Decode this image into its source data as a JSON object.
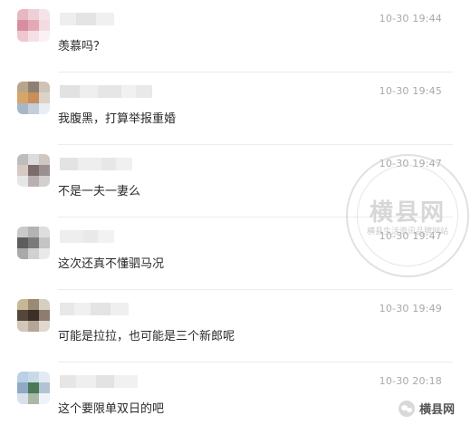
{
  "comments": [
    {
      "time": "10-30 19:44",
      "text": "羡慕吗？",
      "avatar": [
        "#e8b7c2",
        "#f0d0d8",
        "#f6e3e8",
        "#d88e9f",
        "#e4a9b6",
        "#f2dbe1",
        "#eec7d0",
        "#f4e0e6",
        "#fbf1f4"
      ],
      "name": [
        "#eeeeee",
        "#e4e4e4",
        "#f0f0f0"
      ]
    },
    {
      "time": "10-30 19:45",
      "text": "我腹黑，打算举报重婚",
      "avatar": [
        "#b9a58b",
        "#8f7f70",
        "#cfc3b8",
        "#d7a56a",
        "#c88f5a",
        "#ddd2c8",
        "#a7b7c6",
        "#c3ced9",
        "#e9eef2"
      ],
      "name": [
        "#e2e2e2",
        "#efefef",
        "#e6e6e6",
        "#f1f1f1",
        "#e9e9e9"
      ]
    },
    {
      "time": "10-30 19:47",
      "text": "不是一夫一妻么",
      "avatar": [
        "#bdbdbd",
        "#dcdcdc",
        "#cfc8c2",
        "#d6c9c4",
        "#7c6b6c",
        "#9c8f8f",
        "#e6e6e6",
        "#bbb0b0",
        "#d4cfcf"
      ],
      "name": [
        "#e3e3e3",
        "#eeeeee",
        "#e7e7e7",
        "#f0f0f0"
      ]
    },
    {
      "time": "10-30 19:47",
      "text": "这次还真不懂驷马况",
      "avatar": [
        "#c9c9c9",
        "#b3b3b3",
        "#dedede",
        "#5d5d5d",
        "#7a7a7a",
        "#c4c4c4",
        "#a9a9a9",
        "#d1d1d1",
        "#e9e9e9"
      ],
      "name": [
        "#eeeeee",
        "#e9e9e9",
        "#f2f2f2"
      ]
    },
    {
      "time": "10-30 19:49",
      "text": "可能是拉拉，也可能是三个新郎呢",
      "avatar": [
        "#c6b894",
        "#9a8a73",
        "#d5cfc0",
        "#55463a",
        "#3b2f28",
        "#8d7d6e",
        "#d1c6b8",
        "#b4a697",
        "#e0d8cf"
      ],
      "name": [
        "#e8e8e8",
        "#f0f0f0",
        "#e4e4e4",
        "#efefef"
      ]
    },
    {
      "time": "10-30 20:18",
      "text": "这个要限单双日的吧",
      "avatar": [
        "#b9d0e6",
        "#c9d9e8",
        "#e2ebf4",
        "#8fa9c7",
        "#4c7a56",
        "#b3c3d3",
        "#d7e1ec",
        "#a9b9a5",
        "#eef3f8"
      ],
      "name": [
        "#e6e6e6",
        "#efefef",
        "#e3e3e3",
        "#f1f1f1"
      ]
    }
  ],
  "watermark": {
    "big": "横县网",
    "small": "横县生活资讯品牌网站"
  },
  "brand": {
    "icon": "wechat-icon",
    "text": "横县网"
  }
}
